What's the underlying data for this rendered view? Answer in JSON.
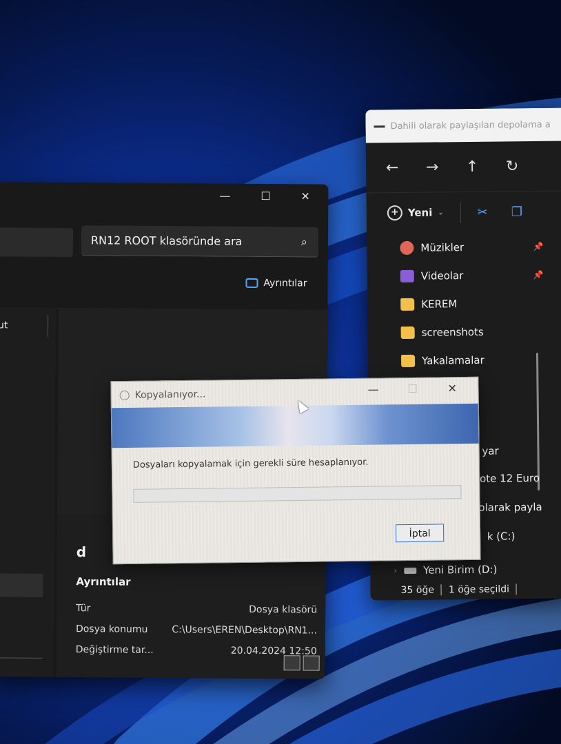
{
  "right_window": {
    "title": "Dahili olarak paylaşılan depolama a",
    "nav": [
      "←",
      "→",
      "↑",
      "↻"
    ],
    "new_label": "Yeni",
    "sidebar": [
      {
        "label": "Müzikler",
        "icon": "music-icon",
        "pinned": true
      },
      {
        "label": "Videolar",
        "icon": "video-icon",
        "pinned": true
      },
      {
        "label": "KEREM",
        "icon": "folder-icon"
      },
      {
        "label": "screenshots",
        "icon": "folder-icon"
      },
      {
        "label": "Yakalamalar",
        "icon": "folder-icon"
      }
    ],
    "partial_items": [
      "yar",
      "lote 12 Euro",
      "olarak payla",
      "k (C:)"
    ],
    "drive": "Yeni Birim (D:)",
    "status_count": "35 öğe",
    "status_selected": "1 öğe seçildi"
  },
  "left_window": {
    "search_placeholder": "RN12 ROOT klasöründe ara",
    "details_button": "Ayrıntılar",
    "column_fragment": "ut",
    "details": {
      "name": "d",
      "heading": "Ayrıntılar",
      "rows": [
        {
          "key": "Tür",
          "value": "Dosya klasörü"
        },
        {
          "key": "Dosya konumu",
          "value": "C:\\Users\\EREN\\Desktop\\RN1..."
        },
        {
          "key": "Değiştirme tar...",
          "value": "20.04.2024 12:50"
        }
      ]
    }
  },
  "dialog": {
    "title": "Kopyalanıyor...",
    "message": "Dosyaları kopyalamak için gerekli süre hesaplanıyor.",
    "progress": 0,
    "cancel_label": "İptal"
  },
  "colors": {
    "accent": "#5aa0ff",
    "folder": "#f2c14b",
    "dialog_bg": "#ece9e4"
  }
}
